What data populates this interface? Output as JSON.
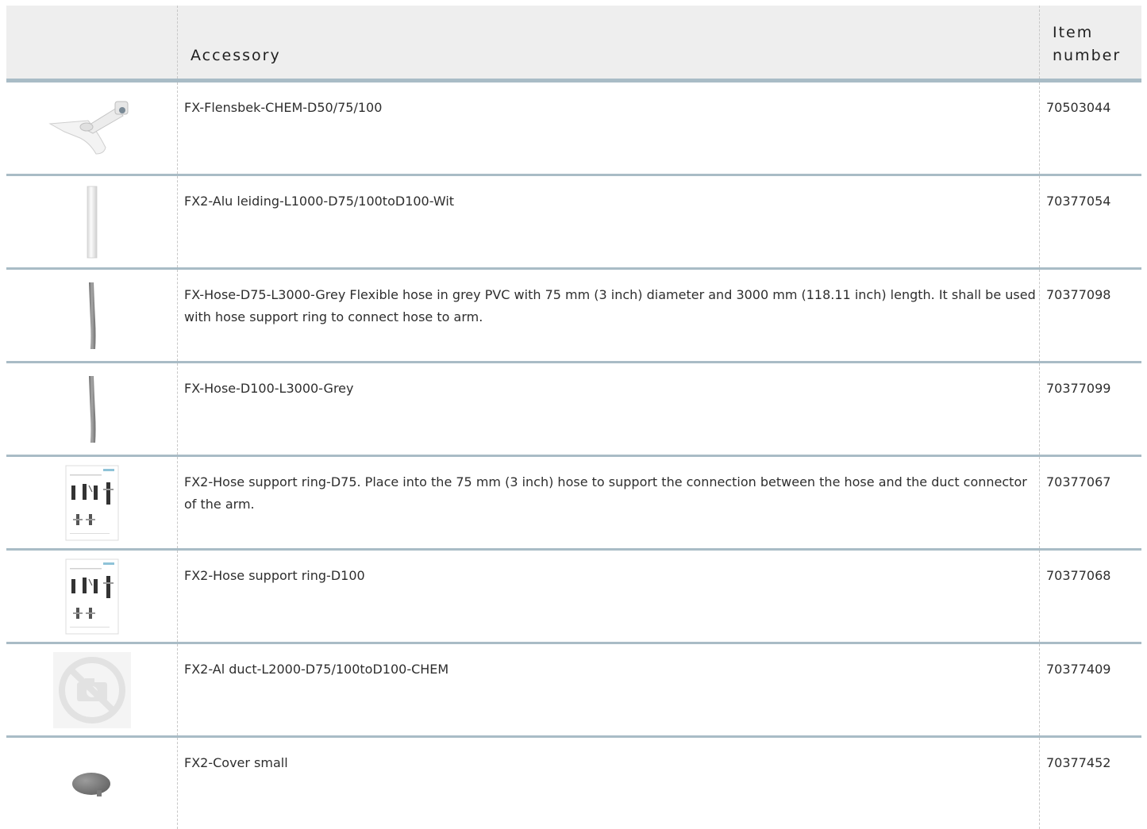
{
  "table": {
    "headers": {
      "image": "",
      "accessory": "Accessory",
      "item_number": "Item number"
    },
    "rows": [
      {
        "accessory": "FX-Flensbek-CHEM-D50/75/100",
        "item_number": "70503044",
        "image_icon": "hood-icon"
      },
      {
        "accessory": "FX2-Alu leiding-L1000-D75/100toD100-Wit",
        "item_number": "70377054",
        "image_icon": "duct-icon"
      },
      {
        "accessory": "FX-Hose-D75-L3000-Grey Flexible hose in grey PVC with 75 mm (3 inch) diameter and 3000 mm (118.11 inch) length. It shall be used with hose support ring to connect hose to arm.",
        "item_number": "70377098",
        "image_icon": "hose-icon"
      },
      {
        "accessory": "FX-Hose-D100-L3000-Grey",
        "item_number": "70377099",
        "image_icon": "hose-icon"
      },
      {
        "accessory": "FX2-Hose support ring-D75. Place into the 75 mm (3 inch) hose to support the connection between the hose and the duct connector of the arm.",
        "item_number": "70377067",
        "image_icon": "drawing-icon"
      },
      {
        "accessory": "FX2-Hose support ring-D100",
        "item_number": "70377068",
        "image_icon": "drawing-icon"
      },
      {
        "accessory": "FX2-Al duct-L2000-D75/100toD100-CHEM",
        "item_number": "70377409",
        "image_icon": "no-image-icon"
      },
      {
        "accessory": "FX2-Cover small",
        "item_number": "70377452",
        "image_icon": "cover-icon"
      }
    ]
  }
}
